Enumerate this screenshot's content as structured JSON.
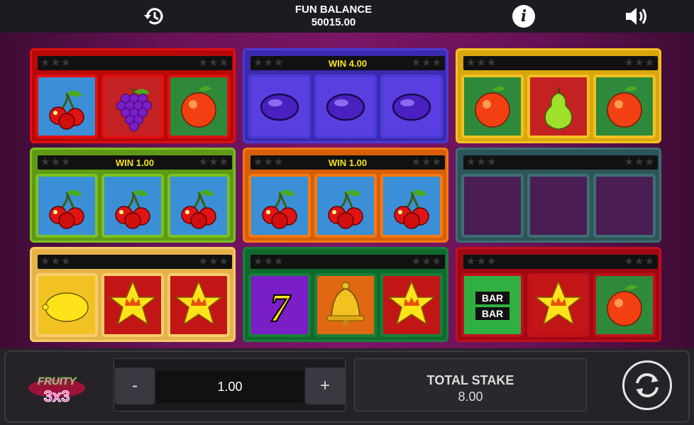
{
  "header": {
    "history_icon": "history-icon",
    "balance_label": "FUN BALANCE",
    "balance_value": "50015.00",
    "info_icon": "info-icon",
    "info_glyph": "i",
    "sound_icon": "speaker-icon"
  },
  "machines": [
    {
      "frame": "#e01010",
      "inner": "#b80808",
      "win": "",
      "symbols": [
        "cherry",
        "grapes",
        "orange"
      ]
    },
    {
      "frame": "#4b3bd8",
      "inner": "#3a2bb0",
      "win": "WIN 4.00",
      "symbols": [
        "plum",
        "plum",
        "plum"
      ]
    },
    {
      "frame": "#f2c222",
      "inner": "#d9a610",
      "win": "",
      "symbols": [
        "orange",
        "pear",
        "orange"
      ]
    },
    {
      "frame": "#7cc022",
      "inner": "#5f9a16",
      "win": "WIN 1.00",
      "symbols": [
        "cherry",
        "cherry",
        "cherry"
      ]
    },
    {
      "frame": "#f47a12",
      "inner": "#d85f08",
      "win": "WIN 1.00",
      "symbols": [
        "cherry",
        "cherry",
        "cherry"
      ]
    },
    {
      "frame": "#3d6f73",
      "inner": "#2d5558",
      "win": "",
      "symbols": [
        "empty",
        "empty",
        "empty"
      ]
    },
    {
      "frame": "#f6cc6a",
      "inner": "#e5b24a",
      "win": "",
      "symbols": [
        "lemon",
        "star",
        "star"
      ]
    },
    {
      "frame": "#18803a",
      "inner": "#106a2e",
      "win": "",
      "symbols": [
        "seven",
        "bell",
        "star"
      ]
    },
    {
      "frame": "#c0101c",
      "inner": "#a00812",
      "win": "",
      "symbols": [
        "bar",
        "star",
        "orange"
      ]
    }
  ],
  "footer": {
    "logo_top": "FRUITY",
    "logo_bottom": "3x3",
    "minus_label": "-",
    "stake_value": "1.00",
    "plus_label": "+",
    "total_stake_label": "TOTAL STAKE",
    "total_stake_value": "8.00",
    "spin_icon": "spin-icon"
  }
}
